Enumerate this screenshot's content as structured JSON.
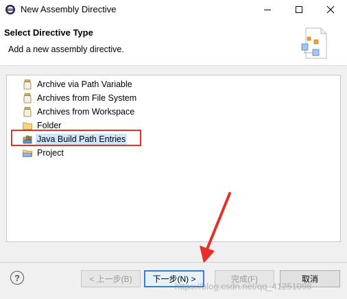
{
  "window": {
    "title": "New Assembly Directive",
    "minimize": "—",
    "maximize": "☐",
    "close": "✕"
  },
  "header": {
    "title": "Select Directive Type",
    "description": "Add a new assembly directive."
  },
  "tree": {
    "items": [
      {
        "label": "Archive via Path Variable",
        "icon": "jar-icon",
        "selected": false
      },
      {
        "label": "Archives from File System",
        "icon": "jar-icon",
        "selected": false
      },
      {
        "label": "Archives from Workspace",
        "icon": "jar-icon",
        "selected": false
      },
      {
        "label": "Folder",
        "icon": "folder-icon",
        "selected": false
      },
      {
        "label": "Java Build Path Entries",
        "icon": "library-icon",
        "selected": true
      },
      {
        "label": "Project",
        "icon": "project-icon",
        "selected": false
      }
    ]
  },
  "footer": {
    "help": "?",
    "back": "< 上一步(B)",
    "next": "下一步(N) >",
    "finish": "完成(F)",
    "cancel": "取消"
  },
  "watermark": "https://blog.csdn.net/qq_41251098",
  "colors": {
    "highlight_border": "#e5302a",
    "selection": "#cce8ff",
    "default_button_border": "#3b7bd0"
  }
}
